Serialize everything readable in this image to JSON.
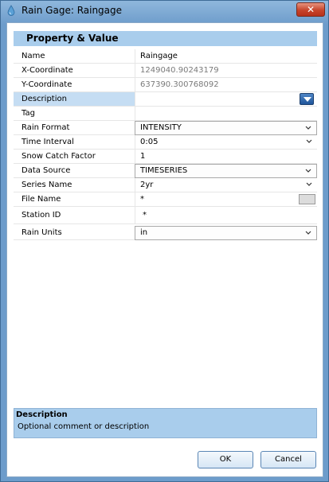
{
  "window": {
    "title": "Rain Gage: Raingage",
    "close_glyph": "✕"
  },
  "header": {
    "title": "Property  &  Value"
  },
  "properties": [
    {
      "name": "Name",
      "value": "Raingage",
      "kind": "text"
    },
    {
      "name": "X-Coordinate",
      "value": "1249040.90243179",
      "kind": "readonly"
    },
    {
      "name": "Y-Coordinate",
      "value": "637390.300768092",
      "kind": "readonly"
    },
    {
      "name": "Description",
      "value": "",
      "kind": "description"
    },
    {
      "name": "Tag",
      "value": "",
      "kind": "text"
    },
    {
      "name": "Rain Format",
      "value": "INTENSITY",
      "kind": "combo"
    },
    {
      "name": "Time Interval",
      "value": "0:05",
      "kind": "dropdown"
    },
    {
      "name": "Snow Catch Factor",
      "value": "1",
      "kind": "text"
    },
    {
      "name": "Data Source",
      "value": "TIMESERIES",
      "kind": "combo"
    },
    {
      "name": "Series Name",
      "value": "2yr",
      "kind": "dropdown"
    },
    {
      "name": "File Name",
      "value": "*",
      "kind": "file"
    },
    {
      "name": "Station ID",
      "value": "*",
      "kind": "text"
    },
    {
      "name": "Rain Units",
      "value": "in",
      "kind": "combo"
    }
  ],
  "description_panel": {
    "title": "Description",
    "text": "Optional comment or description"
  },
  "buttons": {
    "ok": "OK",
    "cancel": "Cancel"
  },
  "icons": {
    "chevron": "chevron-down-icon",
    "dropdown": "triangle-down-icon",
    "browse": "browse-icon",
    "app": "raindrop-icon"
  },
  "colors": {
    "header": "#a9cdec",
    "selected": "#c5ddf3",
    "accent": "#1f559a"
  }
}
